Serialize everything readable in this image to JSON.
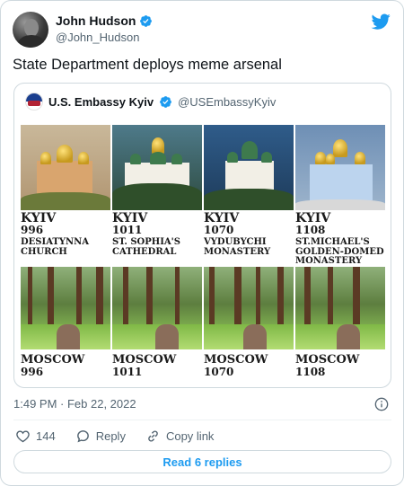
{
  "author": {
    "name": "John Hudson",
    "handle": "@John_Hudson"
  },
  "tweet_text": "State Department deploys meme arsenal",
  "quote": {
    "name": "U.S. Embassy Kyiv",
    "handle": "@USEmbassyKyiv"
  },
  "meme": {
    "kyiv": [
      {
        "city": "KYIV",
        "year": "996",
        "place_line1": "DESIATYNNA",
        "place_line2": "CHURCH",
        "place_line3": ""
      },
      {
        "city": "KYIV",
        "year": "1011",
        "place_line1": "ST. SOPHIA'S",
        "place_line2": "CATHEDRAL",
        "place_line3": ""
      },
      {
        "city": "KYIV",
        "year": "1070",
        "place_line1": "VYDUBYCHI",
        "place_line2": "MONASTERY",
        "place_line3": ""
      },
      {
        "city": "KYIV",
        "year": "1108",
        "place_line1": "ST.MICHAEL'S",
        "place_line2": "GOLDEN-DOMED",
        "place_line3": "MONASTERY"
      }
    ],
    "moscow": [
      {
        "city": "MOSCOW",
        "year": "996"
      },
      {
        "city": "MOSCOW",
        "year": "1011"
      },
      {
        "city": "MOSCOW",
        "year": "1070"
      },
      {
        "city": "MOSCOW",
        "year": "1108"
      }
    ]
  },
  "meta": {
    "timestamp": "1:49 PM · Feb 22, 2022"
  },
  "actions": {
    "like_count": "144",
    "reply_label": "Reply",
    "copy_label": "Copy link"
  },
  "read_replies_label": "Read 6 replies",
  "colors": {
    "accent": "#1d9bf0",
    "muted": "#536471",
    "border": "#cfd9de"
  }
}
